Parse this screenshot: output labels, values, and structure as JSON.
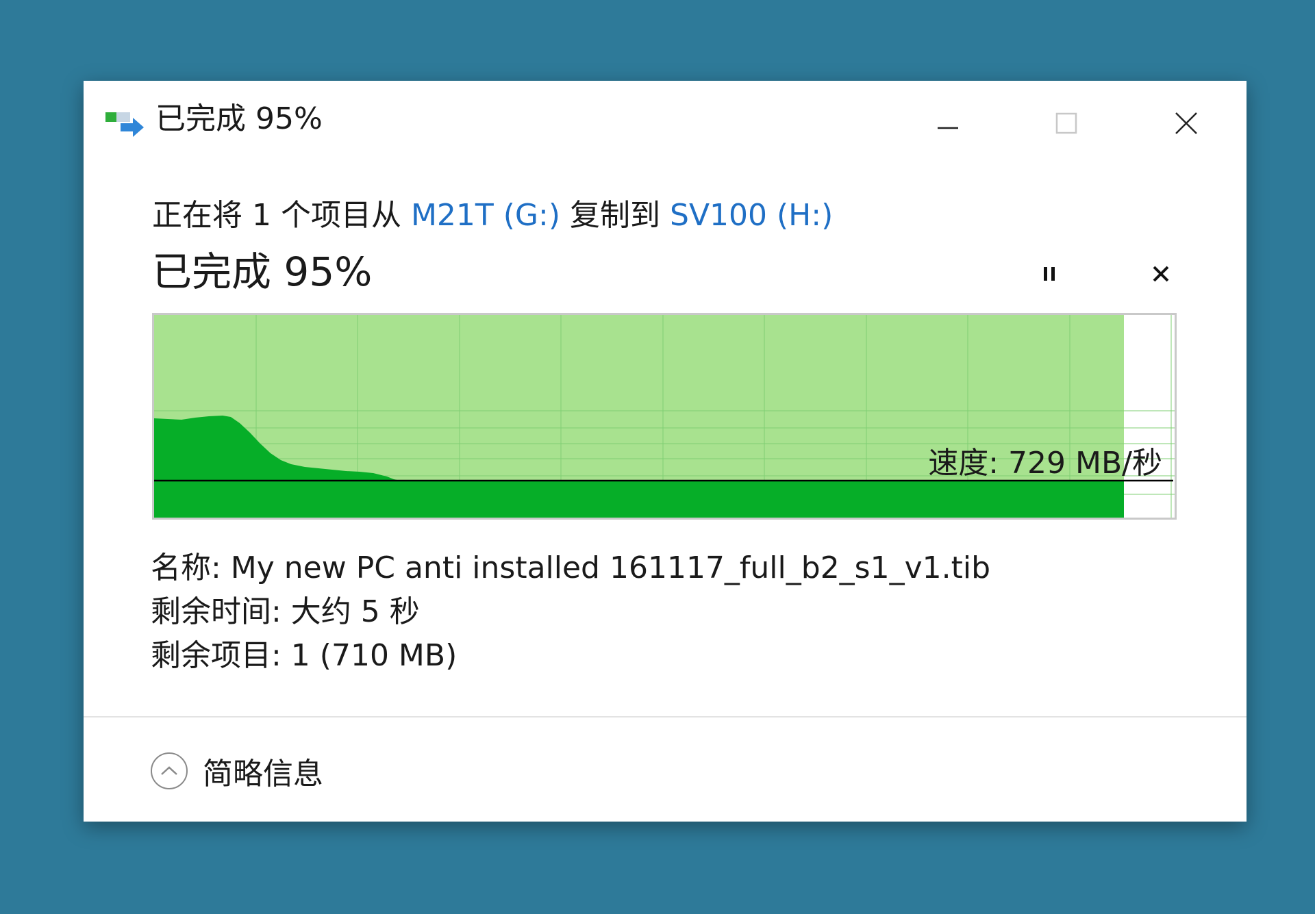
{
  "window": {
    "title": "已完成 95%",
    "icon": "file-copy-icon"
  },
  "copy": {
    "prefix": "正在将 1 个项目从 ",
    "source": "M21T (G:)",
    "middle": " 复制到 ",
    "destination": "SV100 (H:)"
  },
  "status": {
    "percent_label": "已完成 95%",
    "progress_fraction": 0.95
  },
  "graph": {
    "speed_label": "速度: 729 MB/秒",
    "fill_color": "#a8e28f",
    "speed_color": "#06ae28"
  },
  "details": {
    "name_label": "名称: My new PC anti installed 161117_full_b2_s1_v1.tib",
    "time_left_label": "剩余时间: 大约 5 秒",
    "items_left_label": "剩余项目: 1 (710 MB)"
  },
  "footer": {
    "less_info_label": "简略信息"
  },
  "colors": {
    "link": "#1f6fc5",
    "background": "#2e7a99"
  }
}
